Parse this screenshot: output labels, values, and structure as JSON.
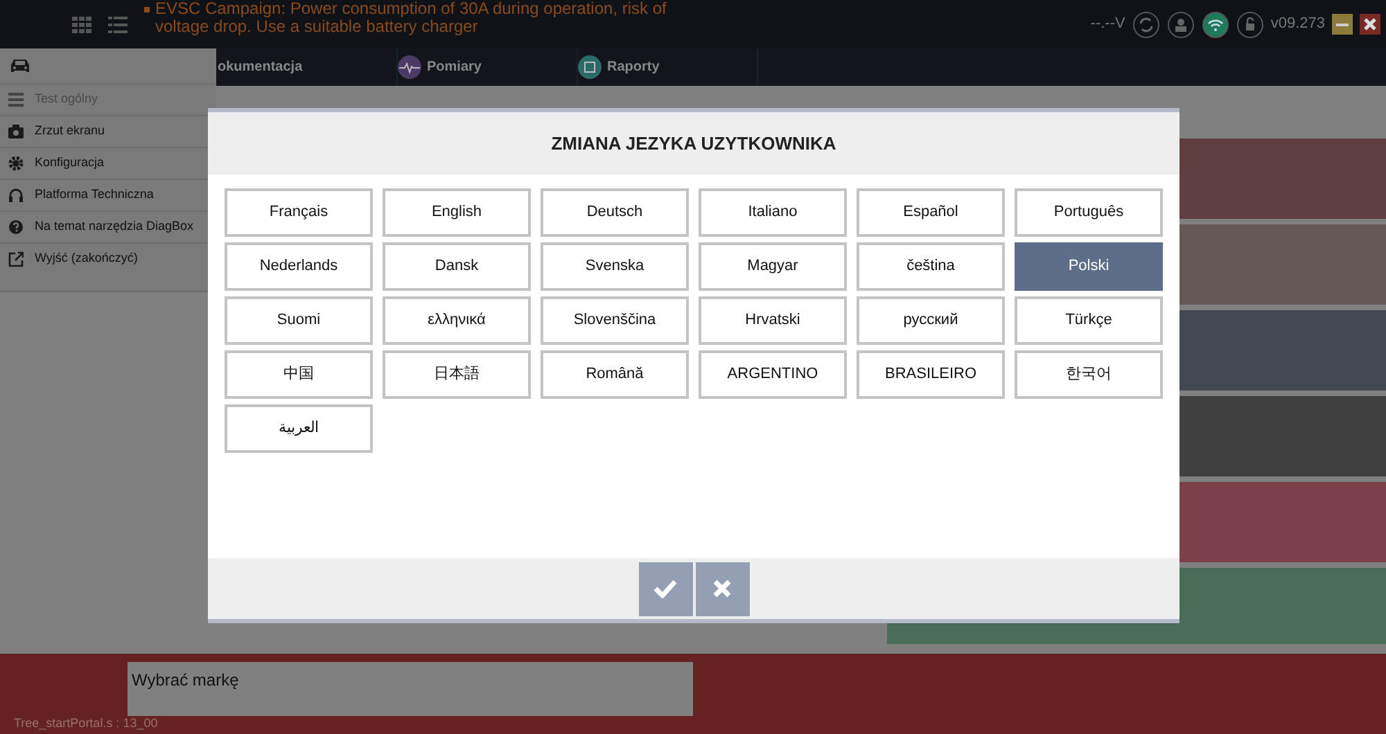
{
  "header": {
    "warnings": [
      "EVSC Campaign: Power consumption of 30A during operation, risk of",
      "voltage drop. Use a suitable battery charger"
    ],
    "voltage": "--.--V",
    "version": "v09.273"
  },
  "nav_tabs": [
    {
      "label": "okumentacja",
      "kind": "plain"
    },
    {
      "label": "Pomiary",
      "kind": "wave"
    },
    {
      "label": "Raporty",
      "kind": "report"
    }
  ],
  "side_menu": {
    "items": [
      {
        "label": "Test ogólny",
        "kind": "test",
        "disabled": true
      },
      {
        "label": "Zrzut ekranu",
        "kind": "camera",
        "disabled": false
      },
      {
        "label": "Konfiguracja",
        "kind": "gear",
        "disabled": false
      },
      {
        "label": "Platforma Techniczna",
        "kind": "headset",
        "disabled": false
      },
      {
        "label": "Na temat narzędzia DiagBox",
        "kind": "help",
        "disabled": false
      },
      {
        "label": "Wyjść (zakończyć)",
        "kind": "exit",
        "disabled": false
      }
    ]
  },
  "dialog": {
    "title": "ZMIANA JEZYKA UZYTKOWNIKA",
    "languages": [
      {
        "label": "Français",
        "selected": false
      },
      {
        "label": "English",
        "selected": false
      },
      {
        "label": "Deutsch",
        "selected": false
      },
      {
        "label": "Italiano",
        "selected": false
      },
      {
        "label": "Español",
        "selected": false
      },
      {
        "label": "Português",
        "selected": false
      },
      {
        "label": "Nederlands",
        "selected": false
      },
      {
        "label": "Dansk",
        "selected": false
      },
      {
        "label": "Svenska",
        "selected": false
      },
      {
        "label": "Magyar",
        "selected": false
      },
      {
        "label": "čeština",
        "selected": false
      },
      {
        "label": "Polski",
        "selected": true
      },
      {
        "label": "Suomi",
        "selected": false
      },
      {
        "label": "ελληνικά",
        "selected": false
      },
      {
        "label": "Slovenščina",
        "selected": false
      },
      {
        "label": "Hrvatski",
        "selected": false
      },
      {
        "label": "русский",
        "selected": false
      },
      {
        "label": "Türkçe",
        "selected": false
      },
      {
        "label": "中国",
        "selected": false
      },
      {
        "label": "日本語",
        "selected": false
      },
      {
        "label": "Română",
        "selected": false
      },
      {
        "label": "ARGENTINO",
        "selected": false
      },
      {
        "label": "BRASILEIRO",
        "selected": false
      },
      {
        "label": "한국어",
        "selected": false
      },
      {
        "label": "العربية",
        "selected": false
      }
    ]
  },
  "brand_field": {
    "value": "Wybrać markę"
  },
  "status_bar": {
    "text": "Tree_startPortal.s : 13_00"
  }
}
